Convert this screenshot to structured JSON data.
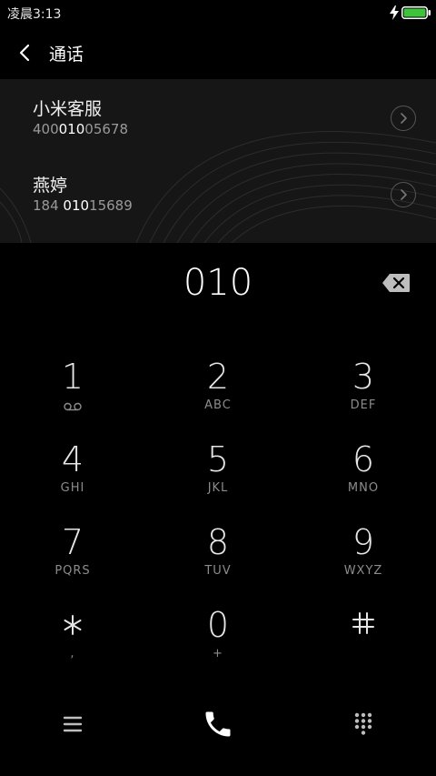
{
  "status_bar": {
    "time": "凌晨3:13"
  },
  "header": {
    "title": "通话"
  },
  "contacts": [
    {
      "name": "小米客服",
      "number_parts": [
        "400",
        "010",
        "05678"
      ]
    },
    {
      "name": "燕婷",
      "number_parts": [
        "184 ",
        "010",
        "15689"
      ]
    }
  ],
  "dial": {
    "number": "010"
  },
  "keypad": {
    "keys": [
      {
        "digit": "1",
        "letters": ""
      },
      {
        "digit": "2",
        "letters": "ABC"
      },
      {
        "digit": "3",
        "letters": "DEF"
      },
      {
        "digit": "4",
        "letters": "GHI"
      },
      {
        "digit": "5",
        "letters": "JKL"
      },
      {
        "digit": "6",
        "letters": "MNO"
      },
      {
        "digit": "7",
        "letters": "PQRS"
      },
      {
        "digit": "8",
        "letters": "TUV"
      },
      {
        "digit": "9",
        "letters": "WXYZ"
      },
      {
        "digit": "",
        "letters": ","
      },
      {
        "digit": "0",
        "letters": "+"
      },
      {
        "digit": "",
        "letters": ""
      }
    ]
  },
  "icons": {
    "voicemail": "voicemail-icon",
    "star": "star-icon",
    "hash": "hash-icon",
    "menu": "menu-icon",
    "phone": "phone-icon",
    "keypad": "keypad-icon",
    "backspace": "backspace-icon",
    "battery": "battery-icon",
    "charging": "bolt-icon"
  },
  "colors": {
    "battery_fill": "#3ec43a",
    "number_highlight": "#ffffff",
    "number_dim": "#9a9a9a"
  }
}
